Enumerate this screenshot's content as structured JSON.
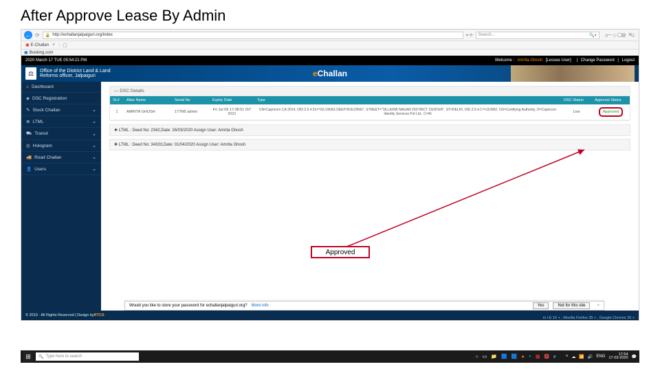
{
  "slide_title": "After Approve Lease By Admin",
  "browser": {
    "url": "http://echallanjalpaiguri.org/index",
    "search_placeholder": "Search...",
    "tab_title": "E-Challan",
    "bookmark": "Booking.com"
  },
  "topbar": {
    "datetime": "2020 March 17 TUE  05:54:21 PM",
    "welcome_label": "Welcome :",
    "welcome_user": "Amrita Ghosh",
    "user_role": "[Lessee User]",
    "change_password": "Change Password",
    "logout": "Logout"
  },
  "banner": {
    "line1": "Office of the District Land & Land",
    "line2": "Reforms officer, Jalpaiguri",
    "brand_e": "e",
    "brand_rest": "Challan"
  },
  "sidebar": {
    "items": [
      {
        "icon": "⌂",
        "label": "Dashboard",
        "expand": false
      },
      {
        "icon": "◈",
        "label": "DSC Registration",
        "expand": false
      },
      {
        "icon": "✎",
        "label": "Stock Challan",
        "expand": true
      },
      {
        "icon": "≣",
        "label": "LTML",
        "expand": true
      },
      {
        "icon": "⛟",
        "label": "Transit",
        "expand": true
      },
      {
        "icon": "◎",
        "label": "Hologram",
        "expand": true
      },
      {
        "icon": "🚚",
        "label": "Road Challan",
        "expand": true
      },
      {
        "icon": "👤",
        "label": "Users",
        "expand": true
      }
    ]
  },
  "dsc": {
    "panel_title": "— DSC Details",
    "headers": {
      "sl": "SL#",
      "alias": "Alias Name",
      "serial": "Serial No",
      "expiry": "Expiry Date",
      "type": "Type",
      "dsc_status": "DSC Status",
      "approval": "Approval Status"
    },
    "rows": [
      {
        "sl": "1",
        "alias": "AMRITA GHOSH",
        "serial": "177M5 admin",
        "expiry": "Fri Jul 09 17:38:51 IST 2021",
        "type": "CN=Capricorn CA 2014, OID.2.5.4.51=\"G5,VIKAS DEEP BUILDING\", STREET=\"18,LAXMI NAGAR DISTRICT CENTER\", ST=DELHI, OID.2.5.4.17=110092, OU=Certifying Authority, O=Capricorn Identity Services Pvt Ltd., C=IN",
        "dsc_status": "Live",
        "approval": "Approved"
      }
    ]
  },
  "accordions": [
    "✚ LTML : Deed No: 2342,Date: 26/03/2020 Assign User: Amrita Ghosh",
    "✚ LTML : Deed No: 34333,Date: 01/04/2020 Assign User: Amrita Ghosh"
  ],
  "callout": "Approved",
  "footer": {
    "copyright": "© 2019 · All Rights Reserved | Design by ",
    "rtcs": "RTCS",
    "compat": "in I.E 10 + , Mozilla Firefox 35 + , Google Chrome 35 +"
  },
  "pw_bar": {
    "text": "Would you like to store your password for echallanjalpaiguri.org?",
    "more": "More info",
    "yes": "Yes",
    "no": "Not for this site"
  },
  "taskbar": {
    "search": "Type here to search",
    "lang": "ENG",
    "time": "17:54",
    "date": "17-03-2020"
  }
}
